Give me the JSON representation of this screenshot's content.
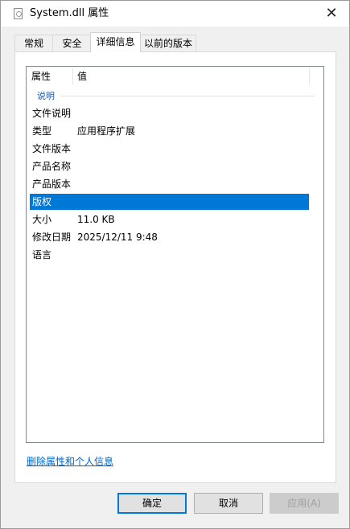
{
  "window": {
    "title": "System.dll 属性",
    "close_label": "✕"
  },
  "tabs": [
    {
      "label": "常规"
    },
    {
      "label": "安全"
    },
    {
      "label": "详细信息"
    },
    {
      "label": "以前的版本"
    }
  ],
  "details": {
    "columns": {
      "name": "属性",
      "value": "值"
    },
    "group_label": "说明",
    "rows": [
      {
        "name": "文件说明",
        "value": ""
      },
      {
        "name": "类型",
        "value": "应用程序扩展"
      },
      {
        "name": "文件版本",
        "value": ""
      },
      {
        "name": "产品名称",
        "value": ""
      },
      {
        "name": "产品版本",
        "value": ""
      },
      {
        "name": "版权",
        "value": ""
      },
      {
        "name": "大小",
        "value": "11.0 KB"
      },
      {
        "name": "修改日期",
        "value": "2025/12/11 9:48"
      },
      {
        "name": "语言",
        "value": ""
      }
    ],
    "selected_row": "版权"
  },
  "remove_link": "删除属性和个人信息",
  "buttons": {
    "ok": "确定",
    "cancel": "取消",
    "apply": "应用(A)"
  },
  "colors": {
    "selection": "#0078d7",
    "link": "#0066cc",
    "group_label": "#1e5aa8"
  }
}
